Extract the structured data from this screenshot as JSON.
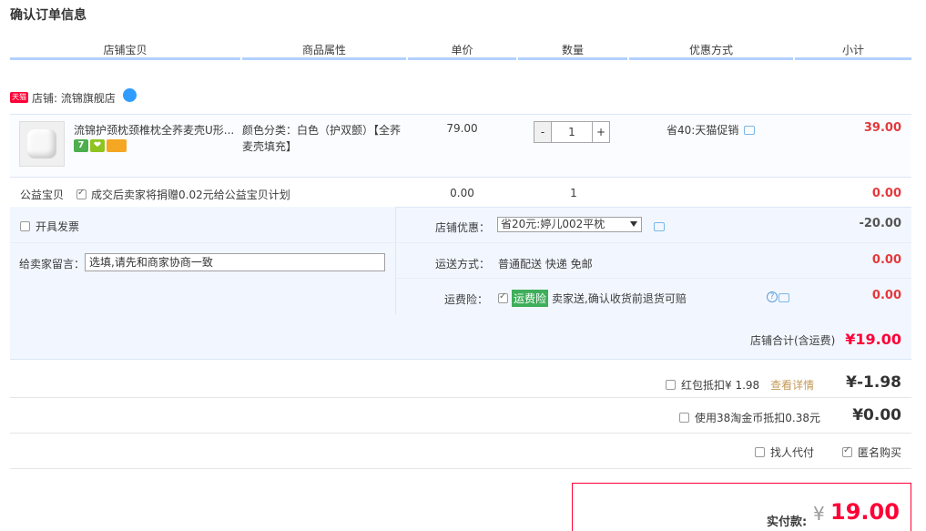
{
  "page": {
    "title": "确认订单信息"
  },
  "headers": [
    "店铺宝贝",
    "商品属性",
    "单价",
    "数量",
    "优惠方式",
    "小计"
  ],
  "shop": {
    "badge": "天猫",
    "label": "店铺: 流锦旗舰店"
  },
  "item": {
    "name": "流锦护颈枕颈椎枕全荞麦壳U形...",
    "icons": [
      "seven-day-return-icon",
      "guarantee-icon",
      "credit-card-icon"
    ],
    "icon_text": [
      "7",
      "❤",
      ""
    ],
    "attr_line1": "颜色分类：白色（护双颤）【全荞",
    "attr_line2": "麦壳填充】",
    "price": "79.00",
    "quantity": "1",
    "qty_minus": "-",
    "qty_plus": "+",
    "promo": "省40:天猫促销",
    "subtotal": "39.00"
  },
  "charity": {
    "label": "公益宝贝",
    "text": "成交后卖家将捐赠0.02元给公益宝贝计划",
    "price": "0.00",
    "quantity": "1",
    "subtotal": "0.00"
  },
  "options": {
    "invoice_label": "开具发票",
    "message_label": "给卖家留言：",
    "message_placeholder": "选填,请先和商家协商一致",
    "shop_discount_label": "店铺优惠：",
    "shop_discount_value": "省20元:婷儿002平枕",
    "shop_discount_amount": "-20.00",
    "shipping_label": "运送方式：",
    "shipping_value": "普通配送 快递 免邮",
    "shipping_amount": "0.00",
    "insurance_label": "运费险：",
    "insurance_tag": "运费险",
    "insurance_text": "卖家送,确认收货前退货可赔",
    "insurance_amount": "0.00"
  },
  "shop_total": {
    "label": "店铺合计(含运费)",
    "amount": "¥19.00"
  },
  "deductions": {
    "redpacket_label": "红包抵扣¥ 1.98",
    "redpacket_link": "查看详情",
    "redpacket_amount": "¥-1.98",
    "coins_label": "使用38淘金币抵扣0.38元",
    "coins_amount": "¥0.00",
    "proxy_label": "找人代付",
    "anonymous_label": "匿名购买"
  },
  "payment": {
    "label": "实付款:",
    "currency": "¥",
    "amount": "19.00"
  },
  "colors": {
    "accent_red": "#ff0036",
    "header_line": "#b2d1ff",
    "panel_bg": "#f2f7ff"
  }
}
